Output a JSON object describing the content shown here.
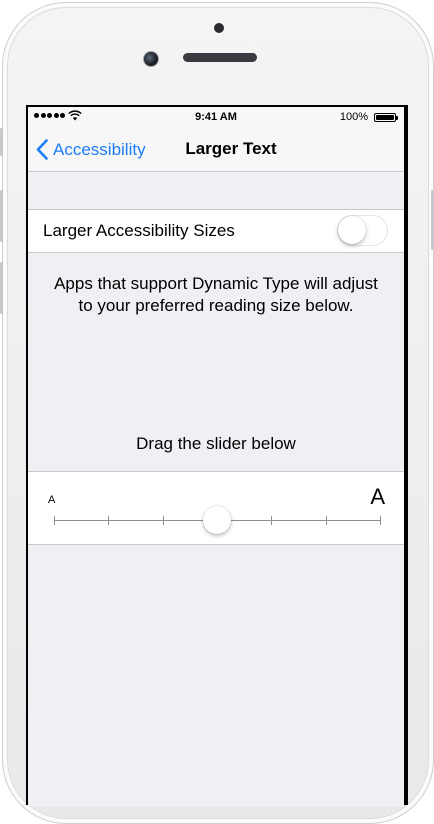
{
  "status_bar": {
    "time": "9:41 AM",
    "battery_percent": "100%",
    "signal_bars": 5,
    "battery_level": 1.0
  },
  "navbar": {
    "back_label": "Accessibility",
    "title": "Larger Text",
    "accent_color": "#1b7ef6"
  },
  "toggle_row": {
    "label": "Larger Accessibility Sizes",
    "on": false
  },
  "description": "Apps that support Dynamic Type will adjust to your preferred reading size below.",
  "slider": {
    "hint": "Drag the slider below",
    "small_label": "A",
    "large_label": "A",
    "steps": 7,
    "selected_step": 4
  },
  "icons": [
    "back-chevron-icon",
    "wifi-icon",
    "battery-icon",
    "signal-dots-icon"
  ]
}
